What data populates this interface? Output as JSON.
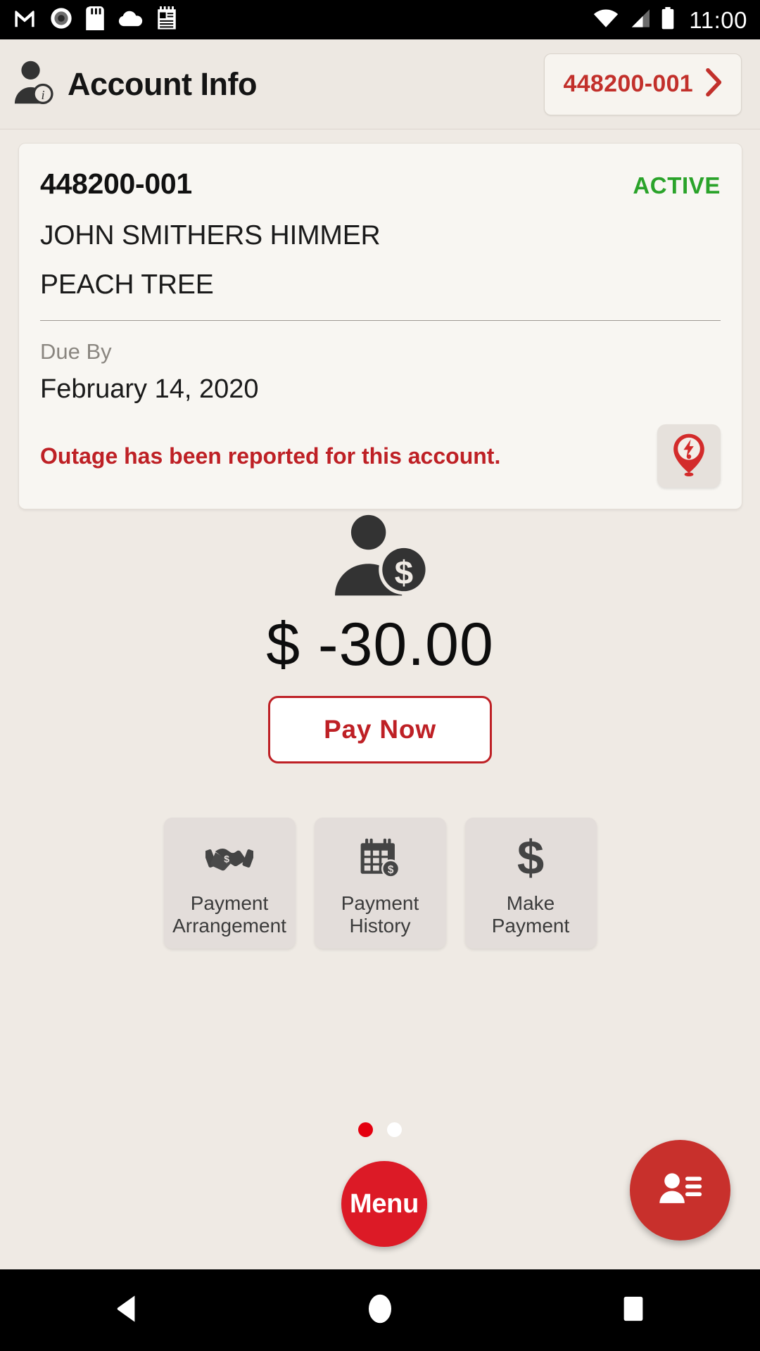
{
  "status_bar": {
    "time": "11:00",
    "left_icons": [
      "gmail-icon",
      "record-circle-icon",
      "sd-card-icon",
      "cloud-icon",
      "notepad-icon"
    ],
    "right_icons": [
      "wifi-icon",
      "cellular-signal-icon",
      "battery-icon"
    ]
  },
  "header": {
    "title": "Account Info",
    "avatar_icon": "account-info-avatar-icon",
    "account_chip": {
      "label": "448200-001",
      "chevron": "chevron-right-icon"
    }
  },
  "account_card": {
    "account_number": "448200-001",
    "status": "ACTIVE",
    "status_color": "#2AA32A",
    "customer_name": "JOHN SMITHERS HIMMER",
    "service_address": "PEACH TREE",
    "due_by_label": "Due By",
    "due_by_date": "February 14, 2020",
    "outage_message": "Outage has been reported for this account.",
    "outage_color": "#BE2025",
    "outage_icon": "outage-pin-icon"
  },
  "balance": {
    "icon": "customer-balance-icon",
    "amount": "$ -30.00",
    "pay_now_label": "Pay Now"
  },
  "tiles": [
    {
      "icon": "handshake-icon",
      "line1": "Payment",
      "line2": "Arrangement"
    },
    {
      "icon": "calendar-dollar-icon",
      "line1": "Payment",
      "line2": "History"
    },
    {
      "icon": "dollar-sign-icon",
      "line1": "Make",
      "line2": "Payment"
    }
  ],
  "pager": {
    "total": 2,
    "active_index": 0,
    "active_color": "#E4000F",
    "inactive_color": "#FFFFFF"
  },
  "menu_button": {
    "label": "Menu",
    "color": "#DC1A26"
  },
  "contact_fab": {
    "icon": "contact-card-icon",
    "color": "#C8302C"
  },
  "nav_bar": {
    "back": "back-triangle-icon",
    "home": "home-circle-icon",
    "recents": "recents-square-icon"
  },
  "theme": {
    "page_background": "#EFEAE4",
    "card_background": "#F8F6F2",
    "tile_background": "#E3DDDA",
    "brand_red": "#BE2025"
  }
}
